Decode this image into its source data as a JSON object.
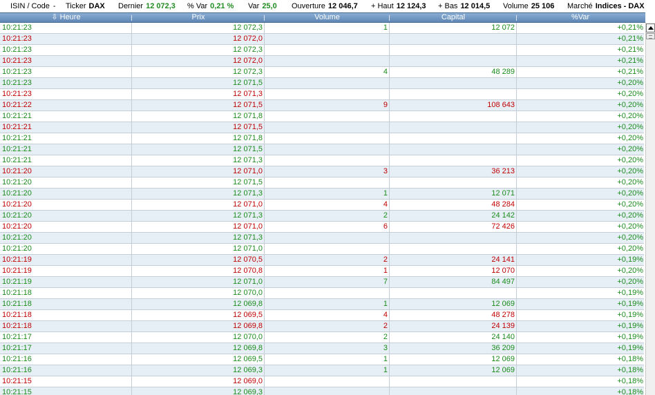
{
  "info": {
    "isin_label": "ISIN / Code",
    "isin_value": "-",
    "ticker_label": "Ticker",
    "ticker_value": "DAX",
    "dernier_label": "Dernier",
    "dernier_value": "12 072,3",
    "pvar_label": "% Var",
    "pvar_value": "0,21 %",
    "var_label": "Var",
    "var_value": "25,0",
    "ouverture_label": "Ouverture",
    "ouverture_value": "12 046,7",
    "haut_label": "+ Haut",
    "haut_value": "12 124,3",
    "bas_label": "+ Bas",
    "bas_value": "12 014,5",
    "volume_label": "Volume",
    "volume_value": "25 106",
    "marche_label": "Marché",
    "marche_value": "Indices - DAX"
  },
  "columns": {
    "heure": "Heure",
    "heure_sort_icon": "down-arrow-icon",
    "prix": "Prix",
    "volume": "Volume",
    "capital": "Capital",
    "var": "%Var"
  },
  "colors": {
    "up": "#1a8c1a",
    "down": "#c00000",
    "header": "#6f94c0"
  },
  "rows": [
    {
      "time": "10:21:23",
      "price": "12 072,3",
      "volume": "1",
      "capital": "12 072",
      "var": "+0,21%",
      "dir": "up"
    },
    {
      "time": "10:21:23",
      "price": "12 072,0",
      "volume": "",
      "capital": "",
      "var": "+0,21%",
      "dir": "down"
    },
    {
      "time": "10:21:23",
      "price": "12 072,3",
      "volume": "",
      "capital": "",
      "var": "+0,21%",
      "dir": "up"
    },
    {
      "time": "10:21:23",
      "price": "12 072,0",
      "volume": "",
      "capital": "",
      "var": "+0,21%",
      "dir": "down"
    },
    {
      "time": "10:21:23",
      "price": "12 072,3",
      "volume": "4",
      "capital": "48 289",
      "var": "+0,21%",
      "dir": "up"
    },
    {
      "time": "10:21:23",
      "price": "12 071,5",
      "volume": "",
      "capital": "",
      "var": "+0,20%",
      "dir": "up"
    },
    {
      "time": "10:21:23",
      "price": "12 071,3",
      "volume": "",
      "capital": "",
      "var": "+0,20%",
      "dir": "down"
    },
    {
      "time": "10:21:22",
      "price": "12 071,5",
      "volume": "9",
      "capital": "108 643",
      "var": "+0,20%",
      "dir": "down"
    },
    {
      "time": "10:21:21",
      "price": "12 071,8",
      "volume": "",
      "capital": "",
      "var": "+0,20%",
      "dir": "up"
    },
    {
      "time": "10:21:21",
      "price": "12 071,5",
      "volume": "",
      "capital": "",
      "var": "+0,20%",
      "dir": "down"
    },
    {
      "time": "10:21:21",
      "price": "12 071,8",
      "volume": "",
      "capital": "",
      "var": "+0,20%",
      "dir": "up"
    },
    {
      "time": "10:21:21",
      "price": "12 071,5",
      "volume": "",
      "capital": "",
      "var": "+0,20%",
      "dir": "up"
    },
    {
      "time": "10:21:21",
      "price": "12 071,3",
      "volume": "",
      "capital": "",
      "var": "+0,20%",
      "dir": "up"
    },
    {
      "time": "10:21:20",
      "price": "12 071,0",
      "volume": "3",
      "capital": "36 213",
      "var": "+0,20%",
      "dir": "down"
    },
    {
      "time": "10:21:20",
      "price": "12 071,5",
      "volume": "",
      "capital": "",
      "var": "+0,20%",
      "dir": "up"
    },
    {
      "time": "10:21:20",
      "price": "12 071,3",
      "volume": "1",
      "capital": "12 071",
      "var": "+0,20%",
      "dir": "up"
    },
    {
      "time": "10:21:20",
      "price": "12 071,0",
      "volume": "4",
      "capital": "48 284",
      "var": "+0,20%",
      "dir": "down"
    },
    {
      "time": "10:21:20",
      "price": "12 071,3",
      "volume": "2",
      "capital": "24 142",
      "var": "+0,20%",
      "dir": "up"
    },
    {
      "time": "10:21:20",
      "price": "12 071,0",
      "volume": "6",
      "capital": "72 426",
      "var": "+0,20%",
      "dir": "down"
    },
    {
      "time": "10:21:20",
      "price": "12 071,3",
      "volume": "",
      "capital": "",
      "var": "+0,20%",
      "dir": "up"
    },
    {
      "time": "10:21:20",
      "price": "12 071,0",
      "volume": "",
      "capital": "",
      "var": "+0,20%",
      "dir": "up"
    },
    {
      "time": "10:21:19",
      "price": "12 070,5",
      "volume": "2",
      "capital": "24 141",
      "var": "+0,19%",
      "dir": "down"
    },
    {
      "time": "10:21:19",
      "price": "12 070,8",
      "volume": "1",
      "capital": "12 070",
      "var": "+0,20%",
      "dir": "down"
    },
    {
      "time": "10:21:19",
      "price": "12 071,0",
      "volume": "7",
      "capital": "84 497",
      "var": "+0,20%",
      "dir": "up"
    },
    {
      "time": "10:21:18",
      "price": "12 070,0",
      "volume": "",
      "capital": "",
      "var": "+0,19%",
      "dir": "up"
    },
    {
      "time": "10:21:18",
      "price": "12 069,8",
      "volume": "1",
      "capital": "12 069",
      "var": "+0,19%",
      "dir": "up"
    },
    {
      "time": "10:21:18",
      "price": "12 069,5",
      "volume": "4",
      "capital": "48 278",
      "var": "+0,19%",
      "dir": "down"
    },
    {
      "time": "10:21:18",
      "price": "12 069,8",
      "volume": "2",
      "capital": "24 139",
      "var": "+0,19%",
      "dir": "down"
    },
    {
      "time": "10:21:17",
      "price": "12 070,0",
      "volume": "2",
      "capital": "24 140",
      "var": "+0,19%",
      "dir": "up"
    },
    {
      "time": "10:21:17",
      "price": "12 069,8",
      "volume": "3",
      "capital": "36 209",
      "var": "+0,19%",
      "dir": "up"
    },
    {
      "time": "10:21:16",
      "price": "12 069,5",
      "volume": "1",
      "capital": "12 069",
      "var": "+0,18%",
      "dir": "up"
    },
    {
      "time": "10:21:16",
      "price": "12 069,3",
      "volume": "1",
      "capital": "12 069",
      "var": "+0,18%",
      "dir": "up"
    },
    {
      "time": "10:21:15",
      "price": "12 069,0",
      "volume": "",
      "capital": "",
      "var": "+0,18%",
      "dir": "down"
    },
    {
      "time": "10:21:15",
      "price": "12 069,3",
      "volume": "",
      "capital": "",
      "var": "+0,18%",
      "dir": "up"
    }
  ]
}
